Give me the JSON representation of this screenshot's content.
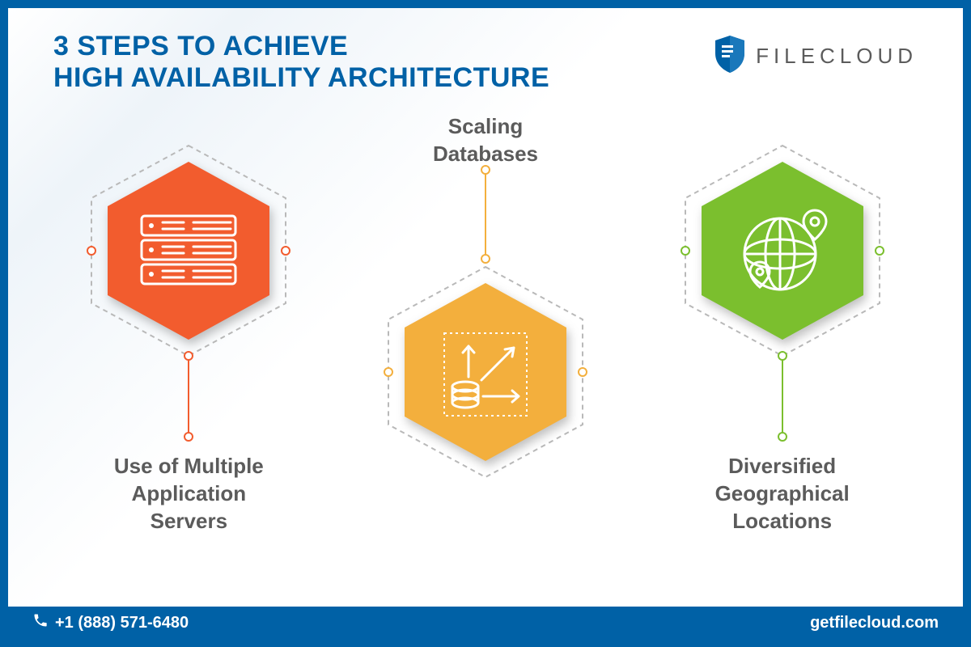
{
  "header": {
    "title_line1": "3 STEPS TO ACHIEVE",
    "title_line2": "HIGH AVAILABILITY ARCHITECTURE",
    "brand": "FILECLOUD"
  },
  "steps": [
    {
      "label": "Use of Multiple\nApplication\nServers",
      "color": "#f25c2e",
      "icon": "servers"
    },
    {
      "label": "Scaling\nDatabases",
      "color": "#f3af3d",
      "icon": "scale-db"
    },
    {
      "label": "Diversified\nGeographical\nLocations",
      "color": "#7bbf2e",
      "icon": "globe-pins"
    }
  ],
  "footer": {
    "phone": "+1 (888) 571-6480",
    "site": "getfilecloud.com"
  },
  "colors": {
    "brand_blue": "#0061a6",
    "text_gray": "#5b5b5b",
    "dash_gray": "#b9b9b9"
  }
}
